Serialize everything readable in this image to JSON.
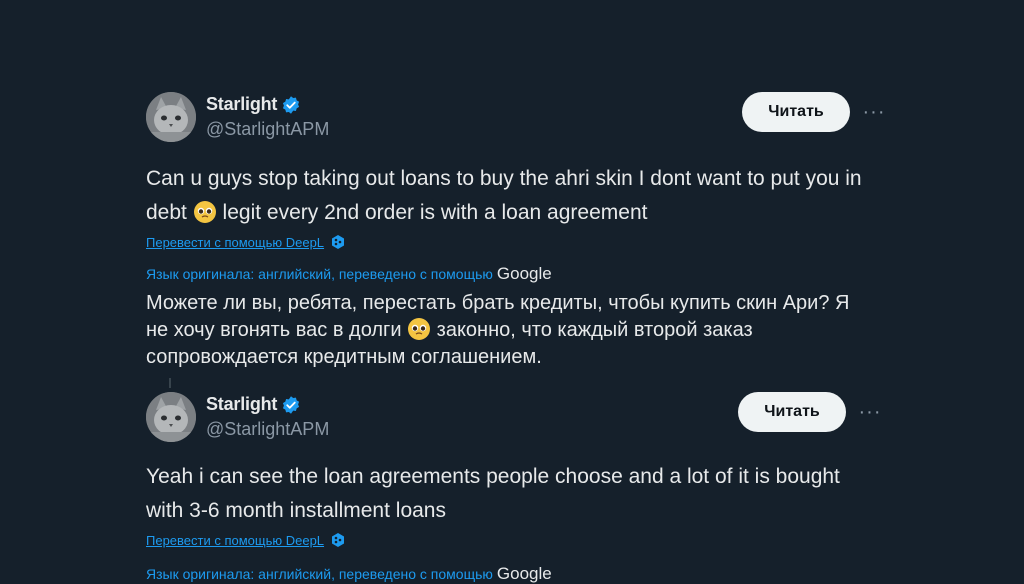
{
  "tweets": [
    {
      "display_name": "Starlight",
      "handle": "@StarlightAPM",
      "follow_label": "Читать",
      "more_label": "···",
      "text_before_emoji": "Can u guys stop taking out loans to buy the ahri skin I dont want to put you in debt ",
      "text_after_emoji": " legit every 2nd order is with a loan agreement",
      "deepl_label": "Перевести с помощью DeepL",
      "translation_note": "Язык оригинала: английский, переведено с помощью",
      "google_label": "Google",
      "translated_before_emoji": "Можете ли вы, ребята, перестать брать кредиты, чтобы купить скин Ари? Я не хочу вгонять вас в долги ",
      "translated_after_emoji": " законно, что каждый второй заказ сопровождается кредитным соглашением."
    },
    {
      "display_name": "Starlight",
      "handle": "@StarlightAPM",
      "follow_label": "Читать",
      "more_label": "···",
      "text": "Yeah i can see the loan agreements people choose and a lot of it is bought with 3-6 month installment loans",
      "deepl_label": "Перевести с помощью DeepL",
      "translation_note": "Язык оригинала: английский, переведено с помощью",
      "google_label": "Google"
    }
  ],
  "icons": {
    "verified": "verified-badge-icon",
    "more": "more-options-icon",
    "emoji": "pleading-face-icon",
    "deepl": "deepl-logo-icon"
  },
  "colors": {
    "background": "#15202b",
    "link": "#1d9bf0",
    "verified": "#1d9bf0",
    "button_bg": "#eff3f4"
  }
}
